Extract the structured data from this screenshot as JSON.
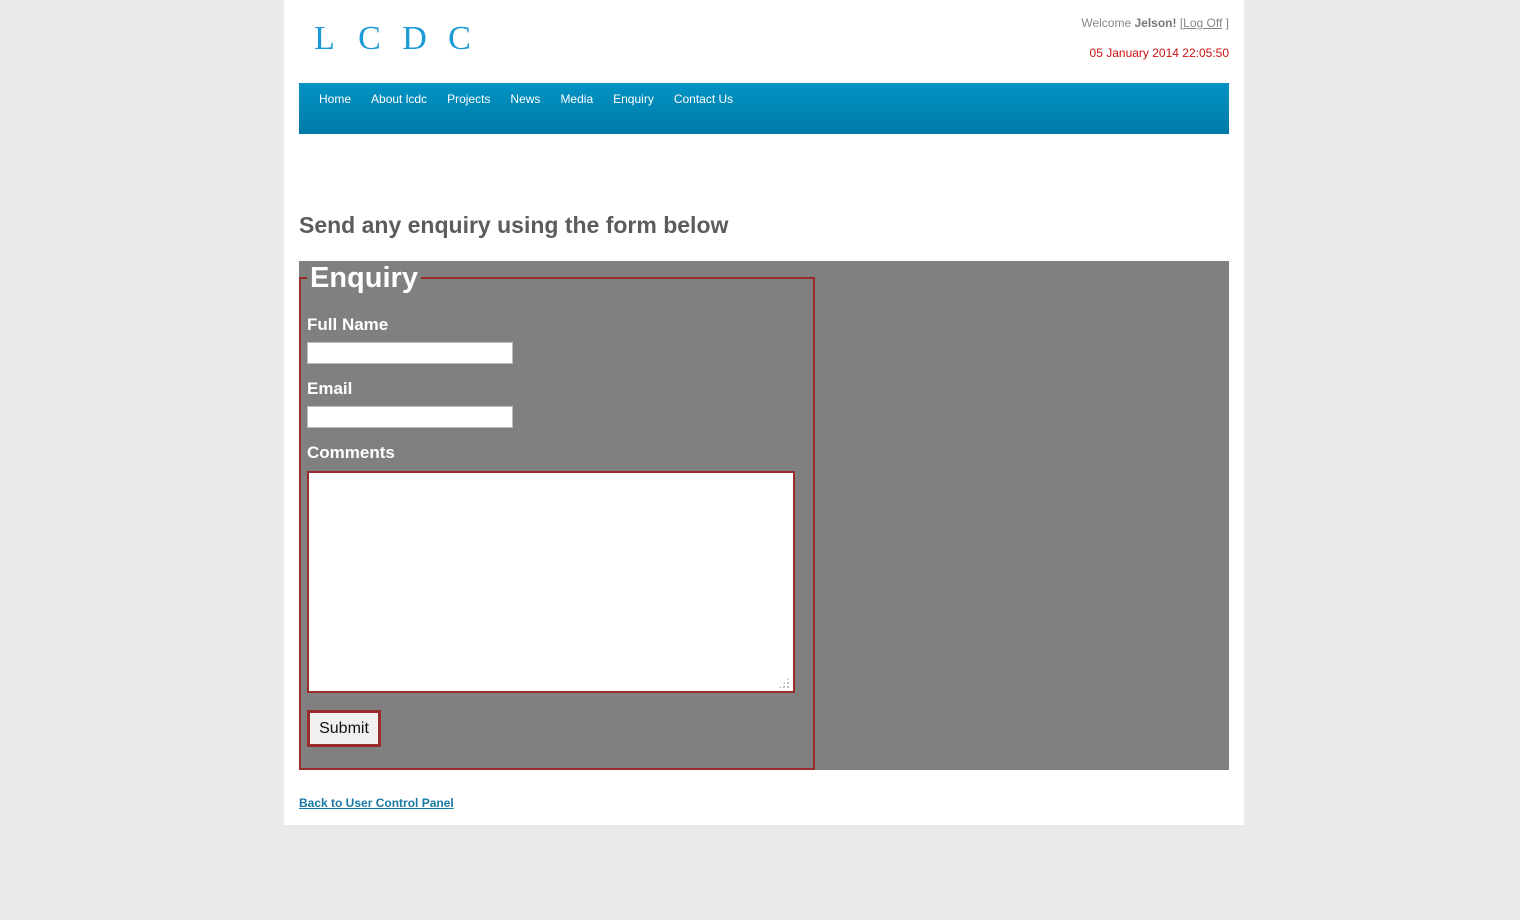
{
  "header": {
    "logo_letters": [
      "L",
      "C",
      "D",
      "C"
    ],
    "welcome_prefix": "Welcome",
    "username": "Jelson!",
    "bracket_open": "[",
    "logoff_label": "Log Off",
    "bracket_close": "]",
    "datetime": "05 January 2014 22:05:50",
    "datetime_color": "#cc1111"
  },
  "nav": {
    "items": [
      "Home",
      "About lcdc",
      "Projects",
      "News",
      "Media",
      "Enquiry",
      "Contact Us"
    ],
    "color": "#0293c4"
  },
  "main": {
    "heading": "Send any enquiry using the form below",
    "form": {
      "legend": "Enquiry",
      "full_name_label": "Full Name",
      "full_name_value": "",
      "email_label": "Email",
      "email_value": "",
      "comments_label": "Comments",
      "comments_value": "",
      "submit_label": "Submit",
      "accent_color": "#9b2c2c"
    },
    "back_link": "Back to User Control Panel"
  }
}
